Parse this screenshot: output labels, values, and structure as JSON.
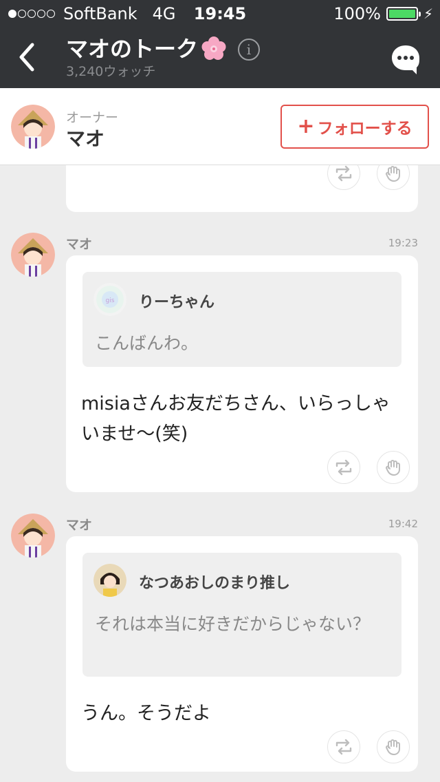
{
  "status_bar": {
    "carrier": "SoftBank",
    "network": "4G",
    "time": "19:45",
    "battery_percent": "100%",
    "battery_level": 1.0,
    "signal_bars": 1
  },
  "nav": {
    "title": "マオのトーク",
    "subtitle": "3,240ウォッチ",
    "info_glyph": "i"
  },
  "owner": {
    "role": "オーナー",
    "name": "マオ",
    "follow_label": "フォローする",
    "follow_plus": "+"
  },
  "posts": [
    {
      "author": "マオ",
      "time": "19:23",
      "quote": {
        "name": "りーちゃん",
        "text": "こんばんわ。"
      },
      "body": "misiaさんお友だちさん、いらっしゃいませ〜(笑)"
    },
    {
      "author": "マオ",
      "time": "19:42",
      "quote": {
        "name": "なつあおしのまり推し",
        "text": "それは本当に好きだからじゃない？"
      },
      "body": "うん。そうだよ"
    }
  ],
  "colors": {
    "header_bg": "#323437",
    "accent_red": "#e2504a",
    "battery_green": "#4cd964",
    "timeline_bg": "#ededed"
  }
}
